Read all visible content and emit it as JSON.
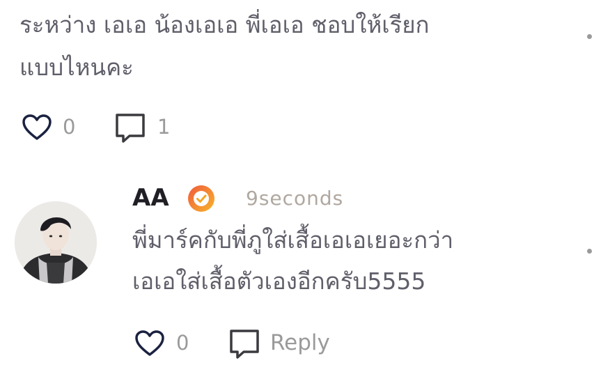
{
  "comment": {
    "text_line1": "ระหว่าง เอเอ น้องเอเอ พี่เอเอ ชอบให้เรียก",
    "text_line2": "แบบไหนคะ",
    "like_count": "0",
    "reply_count": "1",
    "icons": {
      "like": "heart-outline-icon",
      "reply": "speech-bubble-icon",
      "more": "more-options-icon"
    }
  },
  "reply": {
    "author": "AA",
    "timestamp": "9seconds",
    "text_line1": "พี่มาร์คกับพี่ภูใส่เสื้อเอเอเยอะกว่า",
    "text_line2": "เอเอใส่เสื้อตัวเองอีกครับ5555",
    "like_count": "0",
    "reply_label": "Reply",
    "icons": {
      "verified": "verified-badge-icon",
      "like": "heart-outline-icon",
      "reply": "speech-bubble-icon",
      "more": "more-options-icon"
    }
  },
  "colors": {
    "icon_navy": "#1b2240",
    "text_gray": "#5f5f6a",
    "badge_orange": "#f5a623",
    "badge_red": "#f05a3c"
  }
}
